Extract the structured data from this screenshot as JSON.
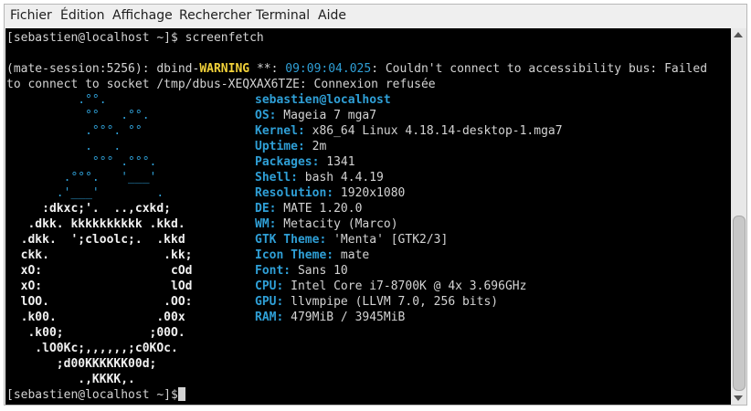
{
  "menubar": {
    "items": [
      "Fichier",
      "Édition",
      "Affichage",
      "Rechercher",
      "Terminal",
      "Aide"
    ]
  },
  "terminal": {
    "prompt": "[sebastien@localhost ~]$",
    "command": " screenfetch",
    "warning_prefix": "(mate-session:5256): dbind-",
    "warning_word": "WARNING",
    "warning_mid": " **: ",
    "warning_time": "09:09:04.025",
    "warning_rest": ": Couldn't connect to accessibility bus: Failed",
    "warning_line2": "to connect to socket /tmp/dbus-XEQXAX6TZE: Connexion refusée",
    "logo_blue": "          .°°.\n           °°   .°°.\n           .°°°. °°\n           .   .\n            °°° .°°°.\n        .°°°.   '___'\n       .'___'        .",
    "logo_white": "     :dkxc;'.  ..,cxkd;\n   .dkk. kkkkkkkkkk .kkd.\n  .dkk.  ';cloolc;.  .kkd\n  ckk.                .kk;\n  xO:                  cOd\n  xO:                  lOd\n  lOO.                .OO:\n  .k00.              .00x\n   .k00;            ;00O.\n    .lO0Kc;,,,,,,;c0KOc.\n       ;d00KKKKKK00d;\n          .,KKKK,.",
    "userhost": "sebastien@localhost",
    "info": [
      {
        "key": "OS:",
        "value": " Mageia 7 mga7"
      },
      {
        "key": "Kernel:",
        "value": " x86_64 Linux 4.18.14-desktop-1.mga7"
      },
      {
        "key": "Uptime:",
        "value": " 2m"
      },
      {
        "key": "Packages:",
        "value": " 1341"
      },
      {
        "key": "Shell:",
        "value": " bash 4.4.19"
      },
      {
        "key": "Resolution:",
        "value": " 1920x1080"
      },
      {
        "key": "DE:",
        "value": " MATE 1.20.0"
      },
      {
        "key": "WM:",
        "value": " Metacity (Marco)"
      },
      {
        "key": "GTK Theme:",
        "value": " 'Menta' [GTK2/3]"
      },
      {
        "key": "Icon Theme:",
        "value": " mate"
      },
      {
        "key": "Font:",
        "value": " Sans 10"
      },
      {
        "key": "CPU:",
        "value": " Intel Core i7-8700K @ 4x 3.696GHz"
      },
      {
        "key": "GPU:",
        "value": " llvmpipe (LLVM 7.0, 256 bits)"
      },
      {
        "key": "RAM:",
        "value": " 479MiB / 3945MiB"
      }
    ],
    "final_prompt": "[sebastien@localhost ~]$"
  },
  "colors": {
    "background": "#000000",
    "text": "#d3d3d3",
    "accent_blue": "#2f9fd6",
    "warning_yellow": "#f2d23a"
  }
}
